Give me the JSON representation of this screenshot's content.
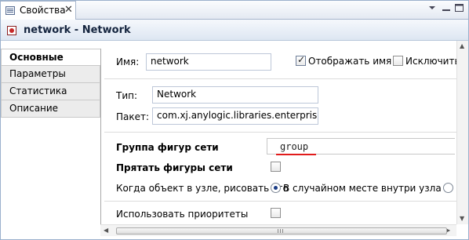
{
  "tab": {
    "label": "Свойства",
    "close": "✕"
  },
  "header": {
    "title": "network - Network"
  },
  "nav": {
    "items": [
      "Основные",
      "Параметры",
      "Статистика",
      "Описание"
    ]
  },
  "form": {
    "name_label": "Имя:",
    "name_value": "network",
    "show_name_label": "Отображать имя",
    "exclude_label": "Исключить",
    "type_label": "Тип:",
    "type_value": "Network",
    "package_label": "Пакет:",
    "package_value": "com.xj.anylogic.libraries.enterprise",
    "group_label": "Группа фигур сети",
    "group_value": "group",
    "hide_label": "Прятать фигуры сети",
    "draw_label": "Когда объект в узле, рисовать его",
    "draw_option": "В случайном месте внутри узла",
    "priorities_label": "Использовать приоритеты"
  },
  "state": {
    "show_name": true,
    "exclude": false,
    "hide": false,
    "priorities": false
  },
  "colors": {
    "accent": "#1b3d86",
    "underline": "#e11b1b",
    "header_bg": "#dde6f2"
  },
  "icons": {
    "tab": "properties-icon",
    "header": "network-object-icon"
  }
}
